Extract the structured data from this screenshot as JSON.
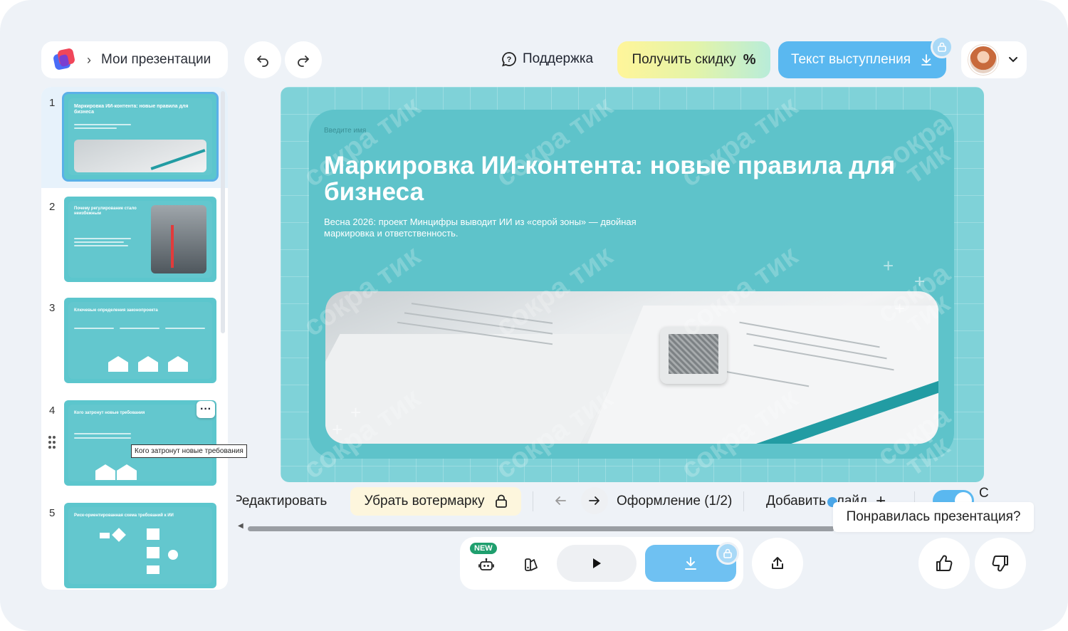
{
  "header": {
    "breadcrumb": "Мои презентации",
    "support_label": "Поддержка",
    "discount_label": "Получить скидку",
    "speech_text_label": "Текст выступления"
  },
  "sidebar": {
    "slides": [
      {
        "number": "1",
        "title": "Маркировка ИИ-контента: новые правила для бизнеса",
        "selected": true
      },
      {
        "number": "2",
        "title": "Почему регулирование стало неизбежным"
      },
      {
        "number": "3",
        "title": "Ключевые определения законопроекта"
      },
      {
        "number": "4",
        "title": "Кого затронут новые требования"
      },
      {
        "number": "5",
        "title": "Риск-ориентированная схема требований к ИИ"
      }
    ],
    "tooltip": "Кого затронут новые требования"
  },
  "slide": {
    "intro_label": "Введите имя",
    "title": "Маркировка ИИ-контента: новые правила для бизнеса",
    "subtitle": "Весна 2026: проект Минцифры выводит ИИ из «серой зоны» — двойная маркировка и ответственность.",
    "watermark": "сокра тик"
  },
  "toolbar": {
    "edit_label": "Редактировать",
    "remove_watermark_label": "Убрать вотермарку",
    "design_label": "Оформление (1/2)",
    "add_slide_label": "Добавить слайд",
    "with_images_label": "С картин"
  },
  "feedback": {
    "prompt": "Понравилась презентация?"
  },
  "bottom": {
    "new_badge": "NEW"
  },
  "colors": {
    "accent_blue": "#5ab8f0",
    "slide_teal": "#5ec3ca",
    "new_green": "#1f9f6e"
  }
}
